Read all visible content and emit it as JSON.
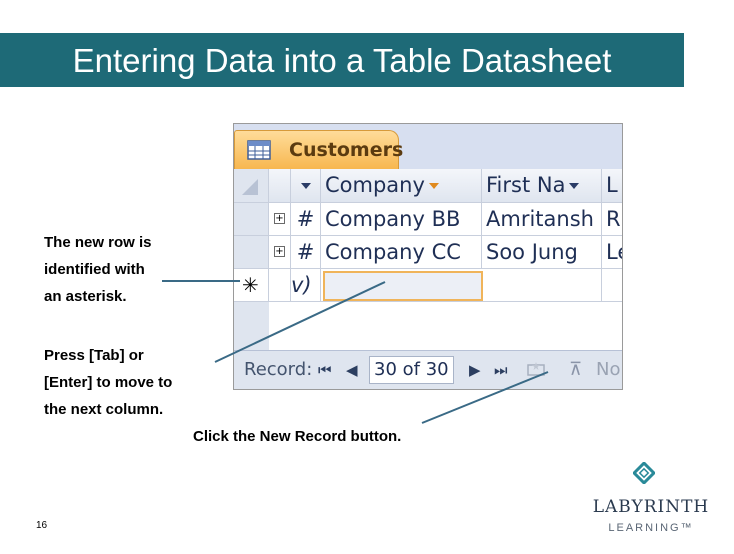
{
  "title": "Entering Data into a Table Datasheet",
  "callouts": {
    "asterisk_lines": [
      "The new row is",
      "identified with",
      "an asterisk."
    ],
    "tab_lines": [
      "Press [Tab] or",
      "[Enter] to move to",
      "the next column."
    ],
    "new_record": "Click the New Record button."
  },
  "access": {
    "tab_label": "Customers",
    "columns": [
      "Company",
      "First Na",
      "L"
    ],
    "rows": [
      {
        "id": "#",
        "company": "Company BB",
        "first": "Amritansh",
        "last": "R"
      },
      {
        "id": "#",
        "company": "Company CC",
        "first": "Soo Jung",
        "last": "Le"
      }
    ],
    "new_row_marker": "✳",
    "new_row_id_fragment": "v)",
    "status": {
      "label": "Record:",
      "first_btn": "⏮",
      "prev_btn": "◀",
      "record_value": "30 of 30",
      "next_btn": "▶",
      "last_btn": "⏭",
      "filter_label": "No"
    }
  },
  "logo": {
    "name": "LABYRINTH",
    "sub": "LEARNING™"
  },
  "page_number": "16",
  "colors": {
    "title_bg": "#1e6a77",
    "tab_orange": "#f7b74f",
    "grid_blue": "#dfe5ef"
  }
}
